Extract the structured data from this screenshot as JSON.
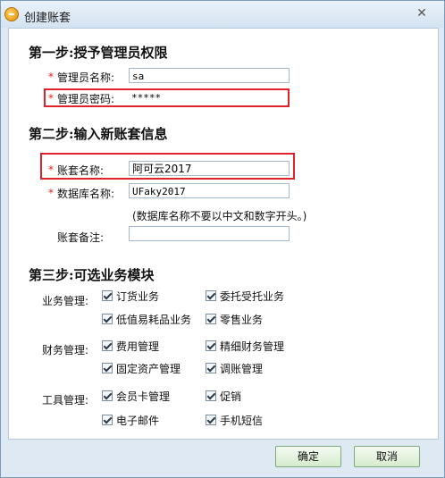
{
  "window": {
    "title": "创建账套",
    "close_symbol": "✕"
  },
  "step1": {
    "title": "第一步:授予管理员权限",
    "required_mark": "*",
    "admin_name_label": "管理员名称:",
    "admin_name_value": "sa",
    "admin_password_label": "管理员密码:",
    "admin_password_value": "*****"
  },
  "step2": {
    "title": "第二步:输入新账套信息",
    "required_mark": "*",
    "account_name_label": "账套名称:",
    "account_name_value": "阿可云2017",
    "db_name_label": "数据库名称:",
    "db_name_value": "UFaky2017",
    "db_hint": "(数据库名称不要以中文和数字开头。)",
    "note_label": "账套备注:",
    "note_value": ""
  },
  "step3": {
    "title": "第三步:可选业务模块",
    "business": {
      "label": "业务管理:",
      "items": [
        "订货业务",
        "委托受托业务",
        "低值易耗品业务",
        "零售业务"
      ]
    },
    "finance": {
      "label": "财务管理:",
      "items": [
        "费用管理",
        "精细财务管理",
        "固定资产管理",
        "调账管理"
      ]
    },
    "tools": {
      "label": "工具管理:",
      "items": [
        "会员卡管理",
        "促销",
        "电子邮件",
        "手机短信"
      ]
    },
    "all_checked": true
  },
  "buttons": {
    "ok": "确定",
    "cancel": "取消"
  },
  "colors": {
    "highlight": "#e0232a",
    "required": "#e0231d",
    "button_bg": "#d5ebcd"
  }
}
